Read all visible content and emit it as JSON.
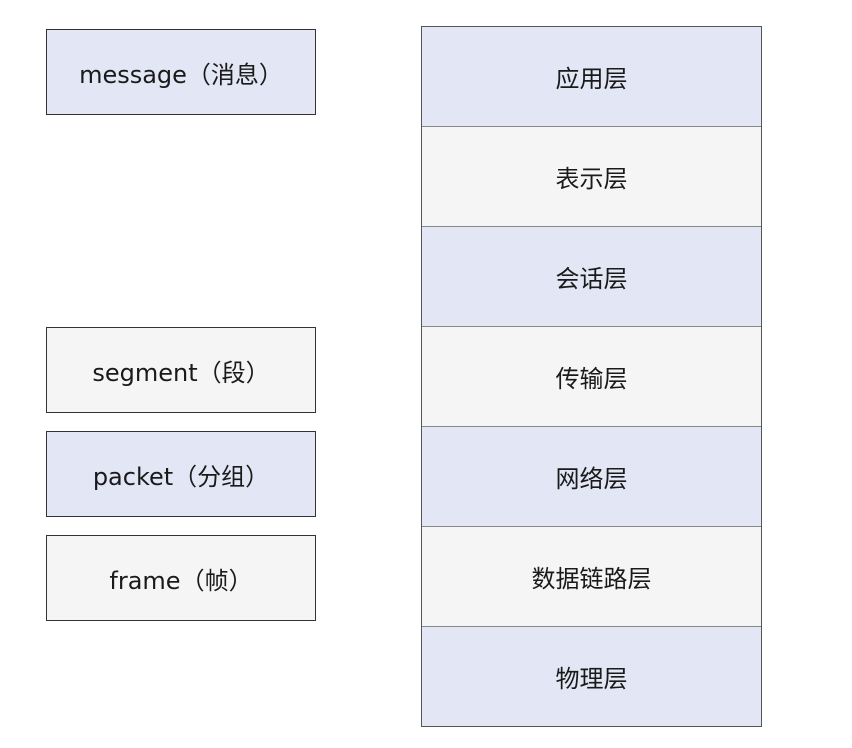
{
  "pdus": [
    {
      "label": "message（消息）"
    },
    {
      "label": "segment（段）"
    },
    {
      "label": "packet（分组）"
    },
    {
      "label": "frame（帧）"
    }
  ],
  "layers": [
    {
      "label": "应用层"
    },
    {
      "label": "表示层"
    },
    {
      "label": "会话层"
    },
    {
      "label": "传输层"
    },
    {
      "label": "网络层"
    },
    {
      "label": "数据链路层"
    },
    {
      "label": "物理层"
    }
  ],
  "colors": {
    "shaded": "#e3e6f5",
    "plain": "#f5f5f5",
    "border": "#333333"
  }
}
